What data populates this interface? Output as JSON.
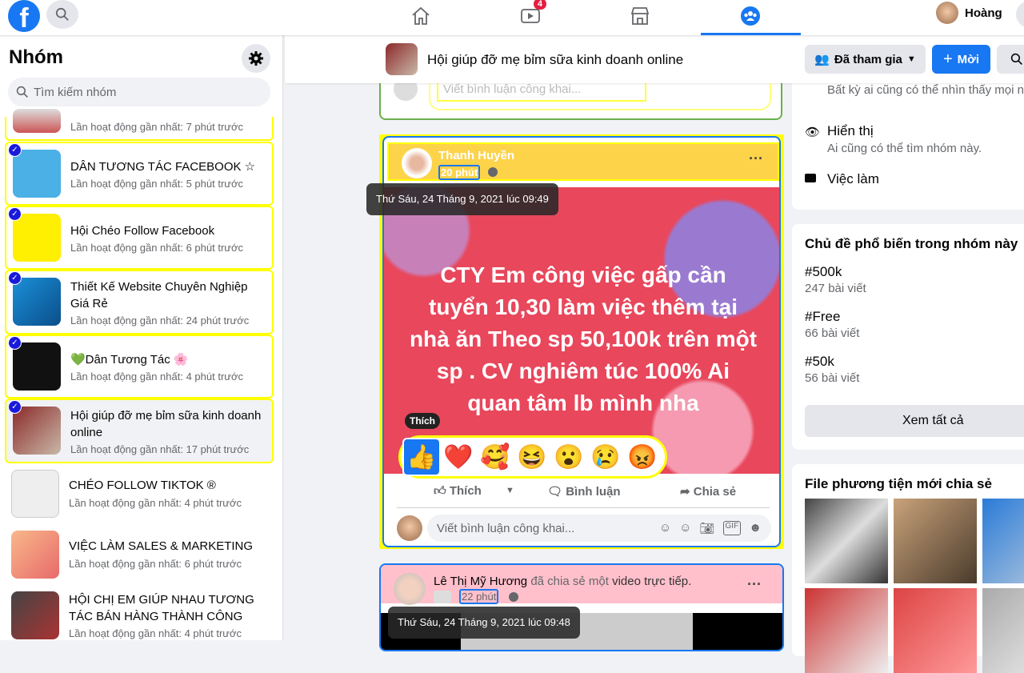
{
  "topbar": {
    "logo": "f",
    "nav": [
      {
        "icon": "home-icon"
      },
      {
        "icon": "watch-icon",
        "badge": "4"
      },
      {
        "icon": "marketplace-icon"
      },
      {
        "icon": "groups-icon",
        "active": true
      }
    ],
    "user_name": "Hoàng"
  },
  "sidebar": {
    "title": "Nhóm",
    "search_placeholder": "Tìm kiếm nhóm",
    "groups": [
      {
        "name": "",
        "status": "Lần hoạt động gần nhất: 7 phút trước",
        "checked": false
      },
      {
        "name": "DÂN TƯƠNG TÁC FACEBOOK ☆",
        "status": "Lần hoạt động gần nhất: 5 phút trước",
        "checked": true
      },
      {
        "name": "Hội Chéo Follow Facebook",
        "status": "Lần hoạt động gần nhất: 6 phút trước",
        "checked": true
      },
      {
        "name": "Thiết Kế Website Chuyên Nghiệp Giá Rẻ",
        "status": "Lần hoạt động gần nhất: 24 phút trước",
        "checked": true
      },
      {
        "name": "💚Dân Tương Tác 🌸",
        "status": "Lần hoạt động gần nhất: 4 phút trước",
        "checked": true
      },
      {
        "name": "Hội giúp đỡ mẹ bỉm sữa kinh doanh online",
        "status": "Lần hoạt động gần nhất: 17 phút trước",
        "checked": true
      },
      {
        "name": "CHÉO FOLLOW TIKTOK ®",
        "status": "Lần hoạt động gần nhất: 4 phút trước"
      },
      {
        "name": "VIỆC LÀM SALES & MARKETING",
        "status": "Lần hoạt động gần nhất: 6 phút trước"
      },
      {
        "name": "HỘI CHỊ EM GIÚP NHAU TƯƠNG TÁC BÁN HÀNG THÀNH CÔNG",
        "status": "Lần hoạt động gần nhất: 4 phút trước"
      }
    ]
  },
  "group_header": {
    "title": "Hội giúp đỡ mẹ bỉm sữa kinh doanh online",
    "joined_label": "Đã tham gia",
    "invite_label": "Mời"
  },
  "feed": {
    "comment_placeholder": "Viết bình luận công khai...",
    "post1": {
      "author": "Thanh Huyền",
      "time": "20 phút",
      "tooltip": "Thứ Sáu, 24 Tháng 9, 2021 lúc 09:49",
      "text": "CTY Em công việc gấp cần tuyển 10,30 làm việc thêm tại nhà ăn Theo sp 50,100k trên một sp . CV nghiêm túc 100% Ai quan tâm lb mình nha",
      "like_tooltip": "Thích",
      "reactions": [
        "👍",
        "❤️",
        "🥰",
        "😆",
        "😮",
        "😢",
        "😡"
      ],
      "actions": {
        "like": "Thích",
        "comment": "Bình luận",
        "share": "Chia sẻ"
      }
    },
    "post2": {
      "author": "Lê Thị Mỹ Hương",
      "action": "đã chia sẻ một",
      "object": "video trực tiếp.",
      "time": "22 phút",
      "tooltip": "Thứ Sáu, 24 Tháng 9, 2021 lúc 09:48"
    }
  },
  "right": {
    "privacy_desc": "Bất kỳ ai cũng có thể nhìn thấy mọi người trong nhóm và những gì họ đăng.",
    "visible_title": "Hiển thị",
    "visible_desc": "Ai cũng có thể tìm nhóm này.",
    "jobs": "Việc làm",
    "topics_title": "Chủ đề phổ biến trong nhóm này",
    "topics": [
      {
        "tag": "#500k",
        "count": "247 bài viết"
      },
      {
        "tag": "#Free",
        "count": "66 bài viết"
      },
      {
        "tag": "#50k",
        "count": "56 bài viết"
      }
    ],
    "see_all": "Xem tất cả",
    "media_title": "File phương tiện mới chia sẻ"
  },
  "colors": {
    "accent": "#1877f2",
    "highlight": "#ffff00",
    "post1_header": "#fdd34a",
    "post2_header": "#ffc0cb",
    "post_bg": "#e8475c"
  }
}
